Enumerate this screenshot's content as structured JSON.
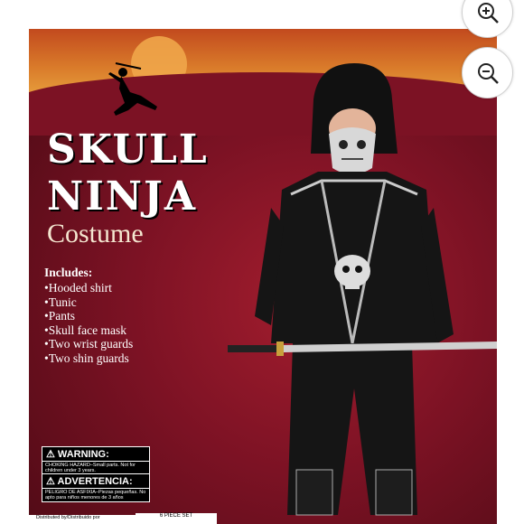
{
  "product_image": {
    "title_line1": "SKULL",
    "title_line2": "NINJA",
    "title_line3": "Costume",
    "includes_heading": "Includes:",
    "includes": [
      "Hooded shirt",
      "Tunic",
      "Pants",
      "Skull face mask",
      "Two wrist guards",
      "Two shin guards"
    ],
    "warning1": {
      "head": "⚠ WARNING:",
      "sub": "CHOKING HAZARD–Small parts. Not for children under 3 years."
    },
    "warning2": {
      "head": "⚠ ADVERTENCIA:",
      "sub": "PELIGRO DE ASFIXIA–Piezas pequeñas. No apto para niños menores de 3 años"
    },
    "set_label": "6 PIECE SET",
    "bottom_text": "Distributed by/Distribuido por"
  },
  "controls": {
    "zoom_in_icon": "magnifier-plus-icon",
    "zoom_out_icon": "magnifier-minus-icon"
  },
  "colors": {
    "background_red": "#7c1224",
    "sky_orange": "#d97a2a"
  }
}
